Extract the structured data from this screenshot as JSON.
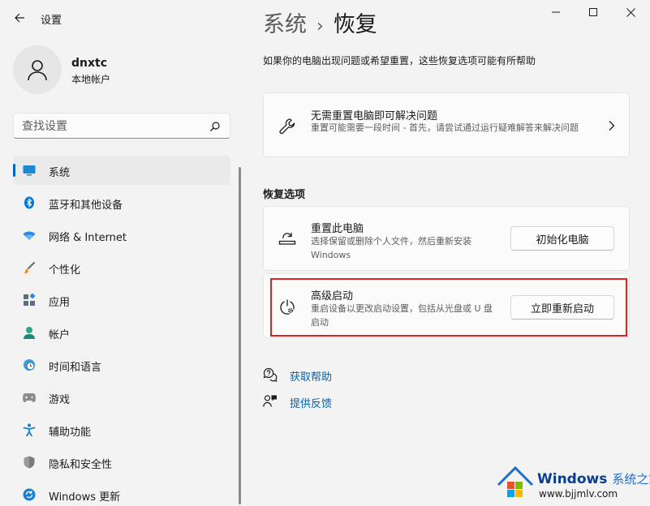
{
  "window": {
    "title": "设置"
  },
  "profile": {
    "name": "dnxtc",
    "account_type": "本地帐户"
  },
  "search": {
    "placeholder": "查找设置"
  },
  "sidebar": {
    "items": [
      {
        "label": "系统",
        "icon": "system-icon",
        "active": true
      },
      {
        "label": "蓝牙和其他设备",
        "icon": "bluetooth-icon"
      },
      {
        "label": "网络 & Internet",
        "icon": "wifi-icon"
      },
      {
        "label": "个性化",
        "icon": "brush-icon"
      },
      {
        "label": "应用",
        "icon": "apps-icon"
      },
      {
        "label": "帐户",
        "icon": "account-icon"
      },
      {
        "label": "时间和语言",
        "icon": "globe-clock-icon"
      },
      {
        "label": "游戏",
        "icon": "gamepad-icon"
      },
      {
        "label": "辅助功能",
        "icon": "accessibility-icon"
      },
      {
        "label": "隐私和安全性",
        "icon": "shield-icon"
      },
      {
        "label": "Windows 更新",
        "icon": "update-icon"
      }
    ]
  },
  "main": {
    "breadcrumb": {
      "parent": "系统",
      "separator": "›",
      "current": "恢复"
    },
    "description": "如果你的电脑出现问题或希望重置，这些恢复选项可能有所帮助",
    "troubleshoot": {
      "title": "无需重置电脑即可解决问题",
      "description": "重置可能需要一段时间 - 首先，请尝试通过运行疑难解答来解决问题"
    },
    "section_title": "恢复选项",
    "reset": {
      "title": "重置此电脑",
      "description": "选择保留或删除个人文件，然后重新安装 Windows",
      "button": "初始化电脑"
    },
    "advanced": {
      "title": "高级启动",
      "description": "重启设备以更改启动设置，包括从光盘或 U 盘启动",
      "button": "立即重新启动"
    },
    "links": [
      {
        "label": "获取帮助",
        "icon": "help-icon"
      },
      {
        "label": "提供反馈",
        "icon": "feedback-icon"
      }
    ]
  },
  "watermark": {
    "title": "Windows",
    "title_cn": "系统之家",
    "url": "www.bjjmlv.com"
  },
  "colors": {
    "accent": "#0067c0",
    "link": "#0063b1",
    "highlight": "#e02020"
  }
}
